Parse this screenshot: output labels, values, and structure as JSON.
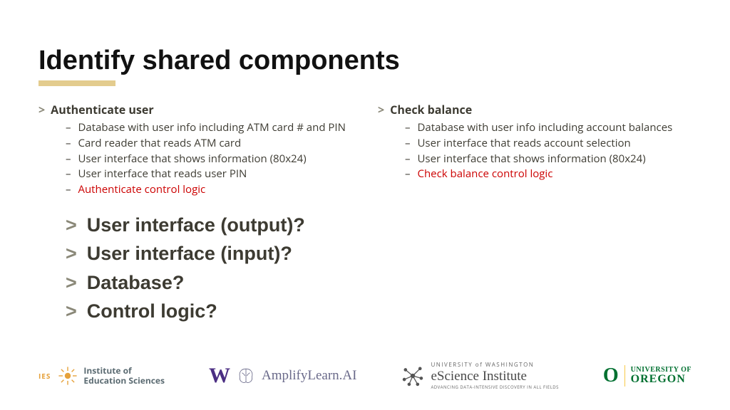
{
  "title": "Identify shared components",
  "left": {
    "heading": "Authenticate user",
    "items": [
      {
        "text": "Database with user info including ATM card # and PIN",
        "red": false
      },
      {
        "text": "Card reader that reads ATM card",
        "red": false
      },
      {
        "text": "User interface that shows information (80x24)",
        "red": false
      },
      {
        "text": "User interface that reads user PIN",
        "red": false
      },
      {
        "text": "Authenticate control logic",
        "red": true
      }
    ]
  },
  "right": {
    "heading": "Check balance",
    "items": [
      {
        "text": "Database with user info including account balances",
        "red": false
      },
      {
        "text": "User interface that reads account selection",
        "red": false
      },
      {
        "text": "User interface that shows information (80x24)",
        "red": false
      },
      {
        "text": "Check balance control logic",
        "red": true
      }
    ]
  },
  "shared": [
    "User interface (output)?",
    "User interface (input)?",
    "Database?",
    "Control logic?"
  ],
  "logos": {
    "ies_label": "IES",
    "ies_line1": "Institute of",
    "ies_line2": "Education Sciences",
    "uw": "W",
    "amplify": "AmplifyLearn.AI",
    "esci_top": "UNIVERSITY of WASHINGTON",
    "esci_main": "eScience Institute",
    "esci_sub": "ADVANCING DATA-INTENSIVE DISCOVERY IN ALL FIELDS",
    "uo_o": "O",
    "uo_line1": "UNIVERSITY OF",
    "uo_line2": "OREGON"
  }
}
